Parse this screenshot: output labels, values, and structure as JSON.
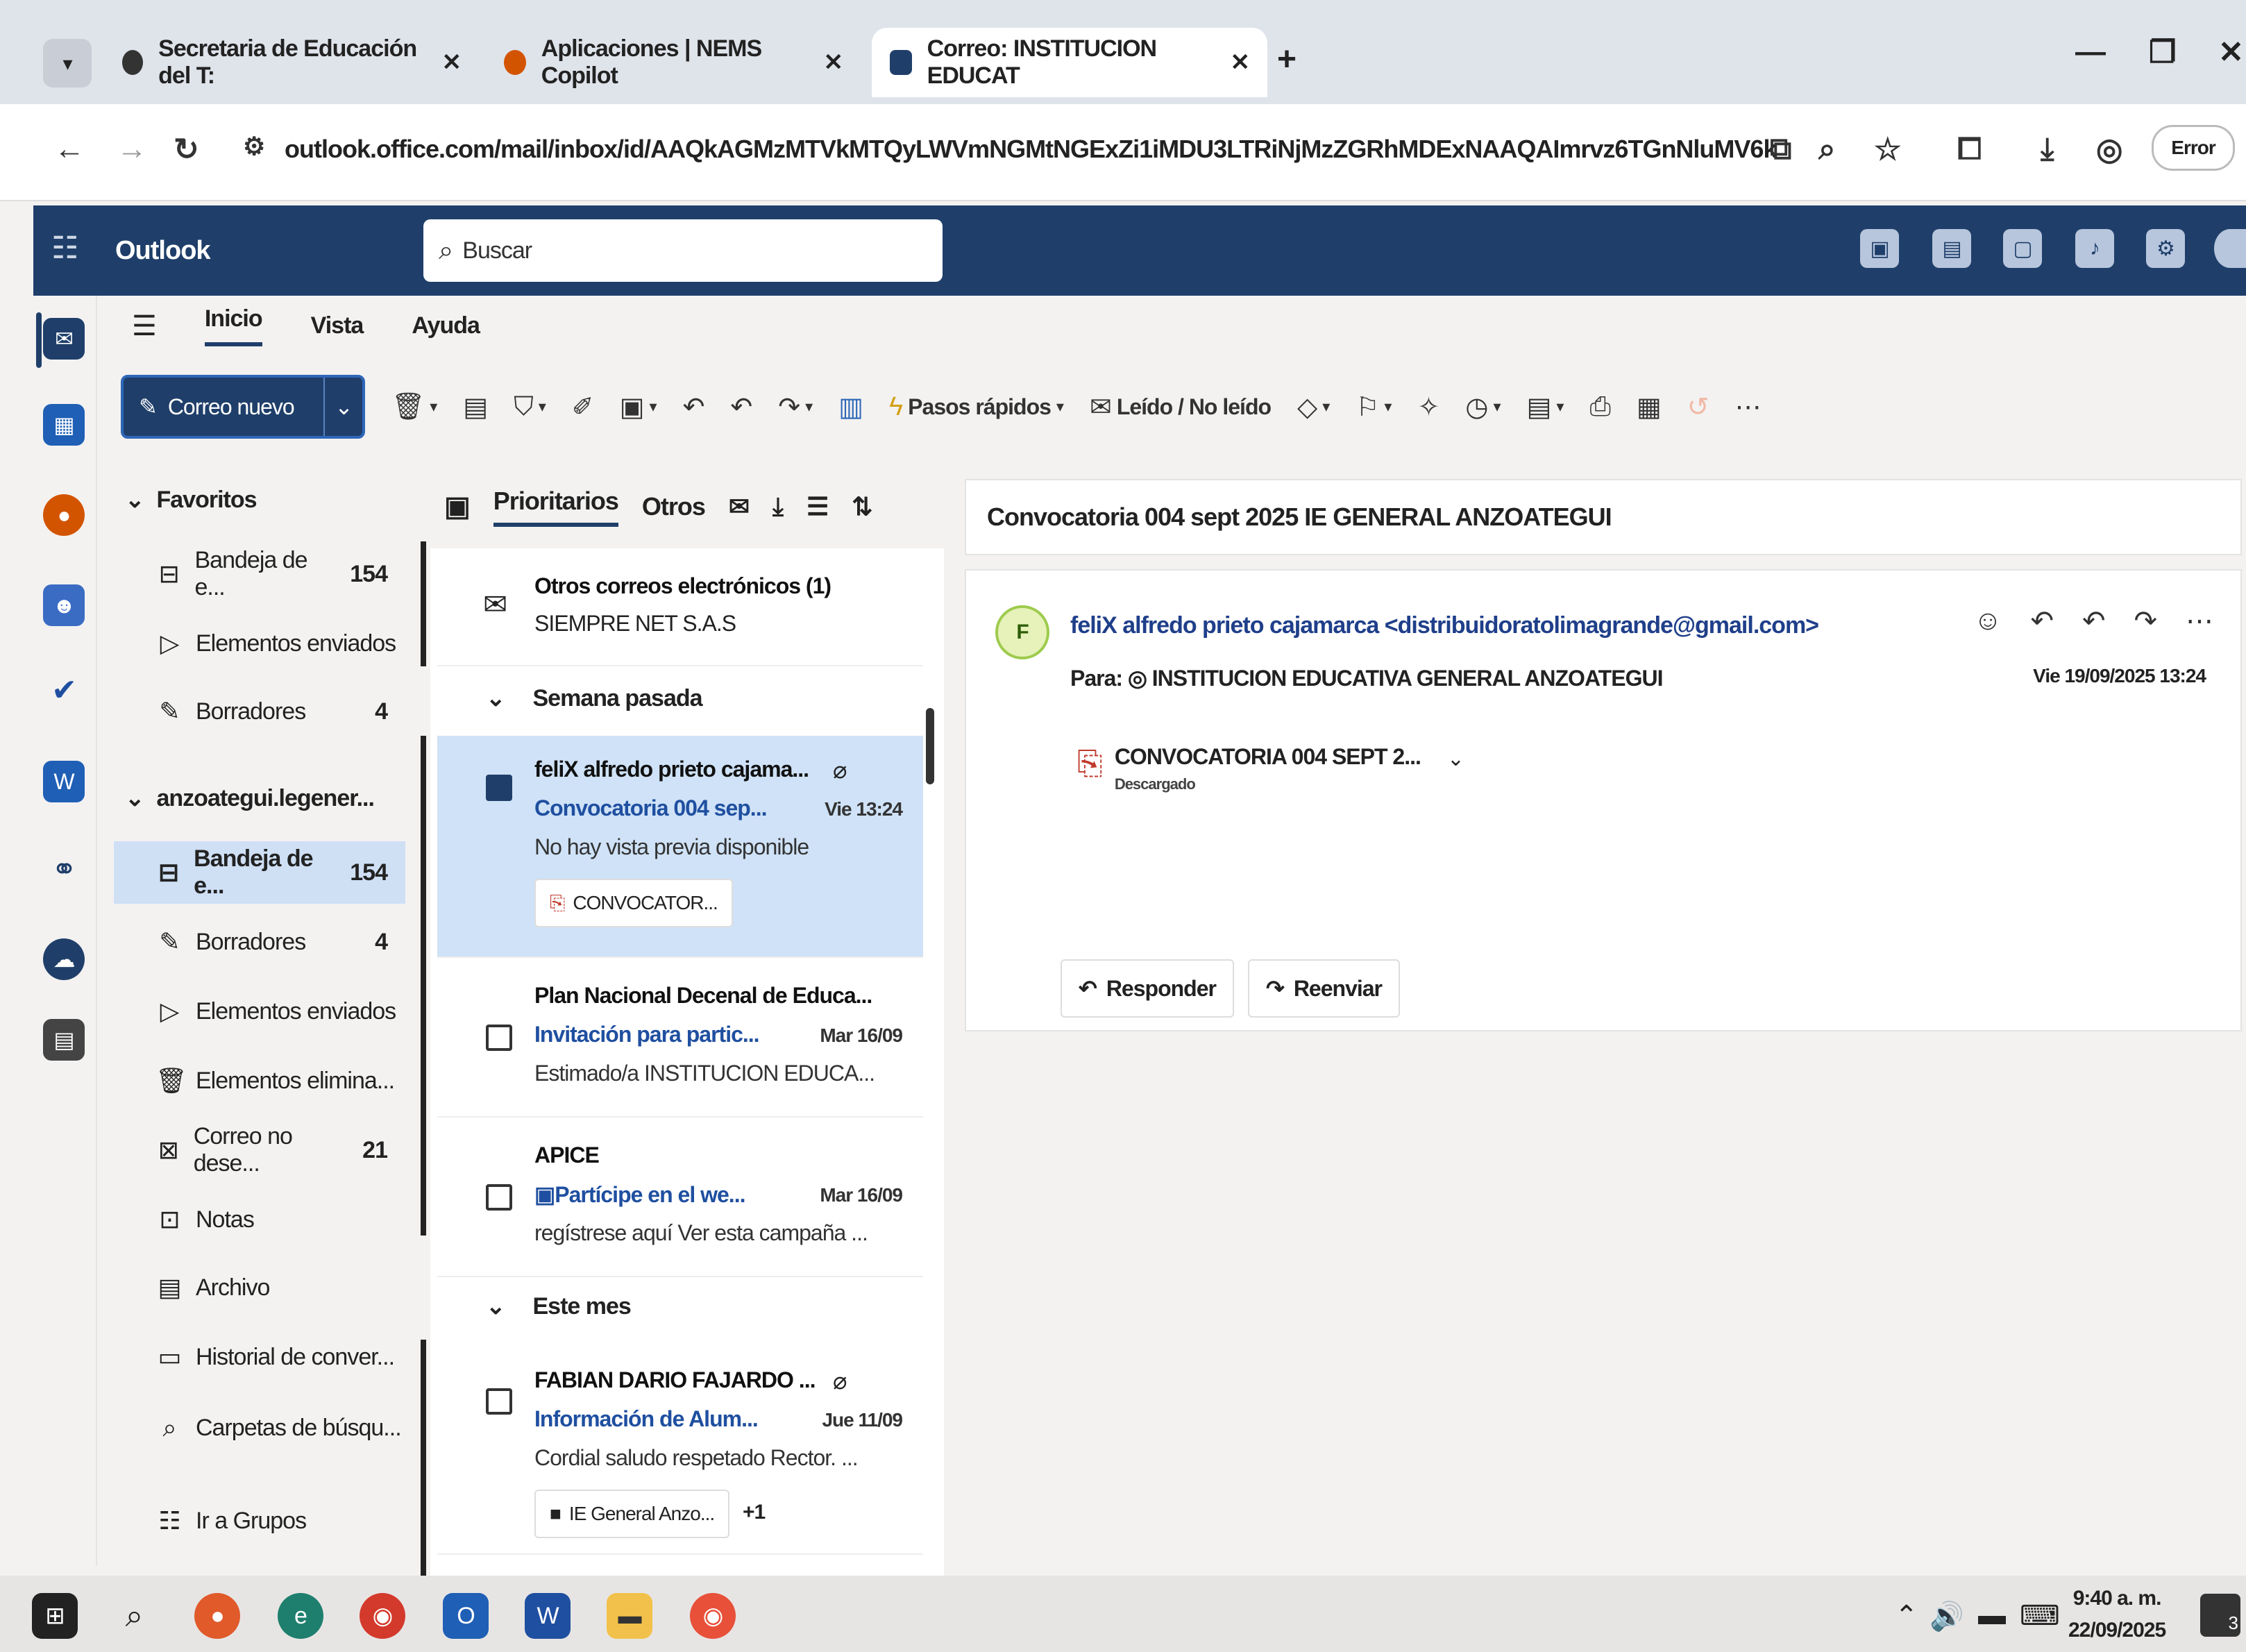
{
  "browser": {
    "tabs": [
      {
        "title": "Secretaria de Educación del T:",
        "active": false
      },
      {
        "title": "Aplicaciones | NEMS Copilot",
        "active": false
      },
      {
        "title": "Correo: INSTITUCION EDUCAT",
        "active": true
      }
    ],
    "url": "outlook.office.com/mail/inbox/id/AAQkAGMzMTVkMTQyLWVmNGMtNGExZi1iMDU3LTRiNjMzZGRhMDExNAAQAImrvz6TGnNluMV6k73HX%2...",
    "profile_label": "Error"
  },
  "app": {
    "name": "Outlook",
    "search_placeholder": "Buscar"
  },
  "ribbon": {
    "tabs": [
      "Inicio",
      "Vista",
      "Ayuda"
    ],
    "active_tab": "Inicio",
    "new_mail_label": "Correo nuevo",
    "quick_steps_label": "Pasos rápidos",
    "read_unread_label": "Leído / No leído"
  },
  "folders": {
    "favorites_label": "Favoritos",
    "favorites": [
      {
        "label": "Bandeja de e...",
        "count": "154"
      },
      {
        "label": "Elementos enviados",
        "count": ""
      },
      {
        "label": "Borradores",
        "count": "4"
      }
    ],
    "account_label": "anzoategui.legener...",
    "account_items": [
      {
        "label": "Bandeja de e...",
        "count": "154"
      },
      {
        "label": "Borradores",
        "count": "4"
      },
      {
        "label": "Elementos enviados",
        "count": ""
      },
      {
        "label": "Elementos elimina...",
        "count": ""
      },
      {
        "label": "Correo no dese...",
        "count": "21"
      },
      {
        "label": "Notas",
        "count": ""
      },
      {
        "label": "Archivo",
        "count": ""
      },
      {
        "label": "Historial de conver...",
        "count": ""
      },
      {
        "label": "Carpetas de búsqu...",
        "count": ""
      }
    ],
    "groups_label": "Ir a Grupos"
  },
  "message_list": {
    "tabs": [
      "Prioritarios",
      "Otros"
    ],
    "other_mail": {
      "title": "Otros correos electrónicos (1)",
      "sender": "SIEMPRE NET S.A.S"
    },
    "sections": [
      "Semana pasada",
      "Este mes"
    ],
    "messages": [
      {
        "sender": "feliX alfredo prieto cajama...",
        "subject": "Convocatoria 004 sep...",
        "date": "Vie 13:24",
        "preview": "No hay vista previa disponible",
        "attachment": "CONVOCATOR..."
      },
      {
        "sender": "Plan Nacional Decenal de Educa...",
        "subject": "Invitación para partic...",
        "date": "Mar 16/09",
        "preview": "Estimado/a INSTITUCION EDUCA..."
      },
      {
        "sender": "APICE",
        "subject": "Partícipe en el we...",
        "date": "Mar 16/09",
        "preview": "regístrese aquí Ver esta campaña ..."
      },
      {
        "sender": "FABIAN DARIO FAJARDO ...",
        "subject": "Información de Alum...",
        "date": "Jue 11/09",
        "preview": "Cordial saludo respetado Rector. ...",
        "attachment": "IE General Anzo...",
        "attachment_extra": "+1"
      }
    ]
  },
  "reading": {
    "subject": "Convocatoria 004 sept 2025 IE GENERAL ANZOATEGUI",
    "avatar_initial": "F",
    "from": "feliX alfredo prieto cajamarca <distribuidoratolimagrande@gmail.com>",
    "to_label": "Para:",
    "to": "INSTITUCION EDUCATIVA GENERAL ANZOATEGUI",
    "date": "Vie 19/09/2025 13:24",
    "attachment_name": "CONVOCATORIA 004 SEPT 2...",
    "attachment_status": "Descargado",
    "reply_label": "Responder",
    "forward_label": "Reenviar"
  },
  "taskbar": {
    "time": "9:40 a. m.",
    "date": "22/09/2025",
    "notif_count": "3"
  },
  "colors": {
    "header": "#1f3f6a",
    "selection": "#cfe2f7",
    "accent": "#2e66b8"
  }
}
